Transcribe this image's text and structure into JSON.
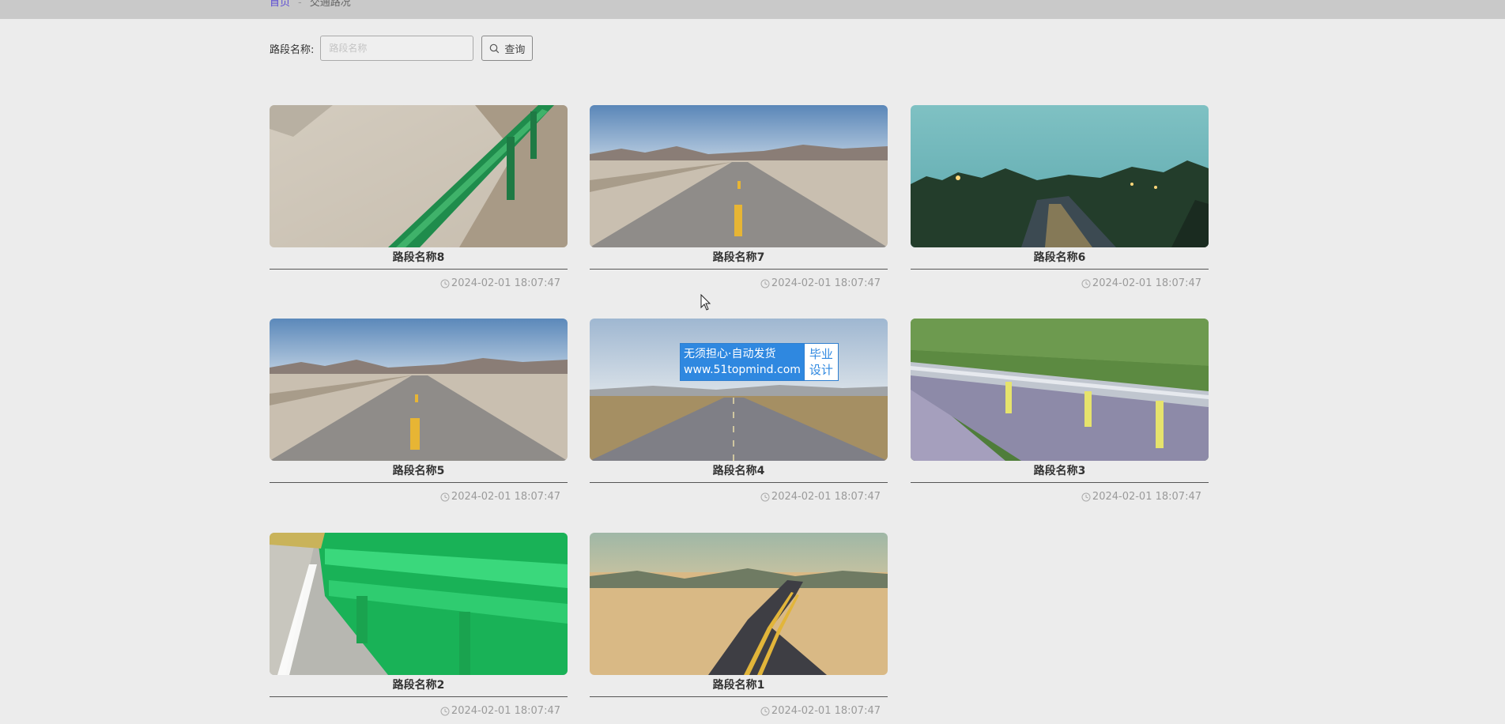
{
  "breadcrumb": {
    "home": "首页",
    "separator": "-",
    "current": "交通路况"
  },
  "search": {
    "label": "路段名称:",
    "placeholder": "路段名称",
    "value": "",
    "button_label": "查询"
  },
  "cards": [
    {
      "title": "路段名称8",
      "time": "2024-02-01 18:07:47"
    },
    {
      "title": "路段名称7",
      "time": "2024-02-01 18:07:47"
    },
    {
      "title": "路段名称6",
      "time": "2024-02-01 18:07:47"
    },
    {
      "title": "路段名称5",
      "time": "2024-02-01 18:07:47"
    },
    {
      "title": "路段名称4",
      "time": "2024-02-01 18:07:47"
    },
    {
      "title": "路段名称3",
      "time": "2024-02-01 18:07:47"
    },
    {
      "title": "路段名称2",
      "time": "2024-02-01 18:07:47"
    },
    {
      "title": "路段名称1",
      "time": "2024-02-01 18:07:47"
    }
  ],
  "watermark": {
    "line1": "无须担心·自动发货",
    "line2": "www.51topmind.com",
    "right1": "毕业",
    "right2": "设计"
  },
  "colors": {
    "accent": "#5b4bd4",
    "page_bg": "#ececec",
    "topbar": "#c9c9c9",
    "watermark_blue": "#2f88e0"
  }
}
